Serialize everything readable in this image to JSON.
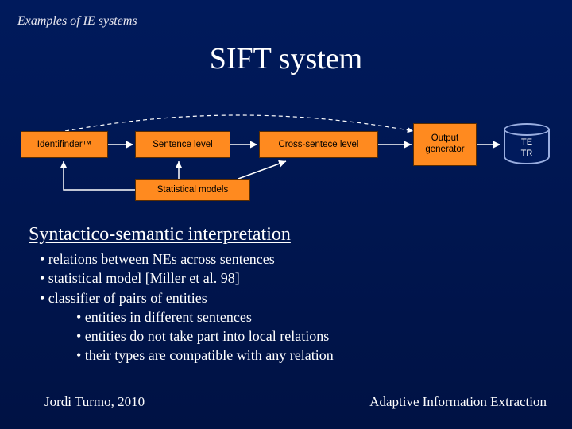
{
  "header_label": "Examples of IE systems",
  "title": "SIFT system",
  "diagram": {
    "identifinder": "Identifinder™",
    "sentence_level": "Sentence level",
    "cross_sentence": "Cross-sentece level",
    "output_generator": "Output generator",
    "statistical_models": "Statistical models",
    "cylinder_line1": "TE",
    "cylinder_line2": "TR"
  },
  "section_heading": "Syntactico-semantic interpretation",
  "bullets": [
    {
      "level": 1,
      "text": "• relations between NEs across sentences"
    },
    {
      "level": 1,
      "text": "• statistical model [Miller et al. 98]"
    },
    {
      "level": 1,
      "text": "• classifier of pairs of entities"
    },
    {
      "level": 2,
      "text": "• entities in different sentences"
    },
    {
      "level": 2,
      "text": "• entities do not take part into local relations"
    },
    {
      "level": 2,
      "text": "• their types are compatible with any relation"
    }
  ],
  "footer": {
    "left": "Jordi Turmo, 2010",
    "right": "Adaptive Information Extraction"
  },
  "colors": {
    "box_fill": "#ff8a1f",
    "bg_top": "#001a5c"
  }
}
